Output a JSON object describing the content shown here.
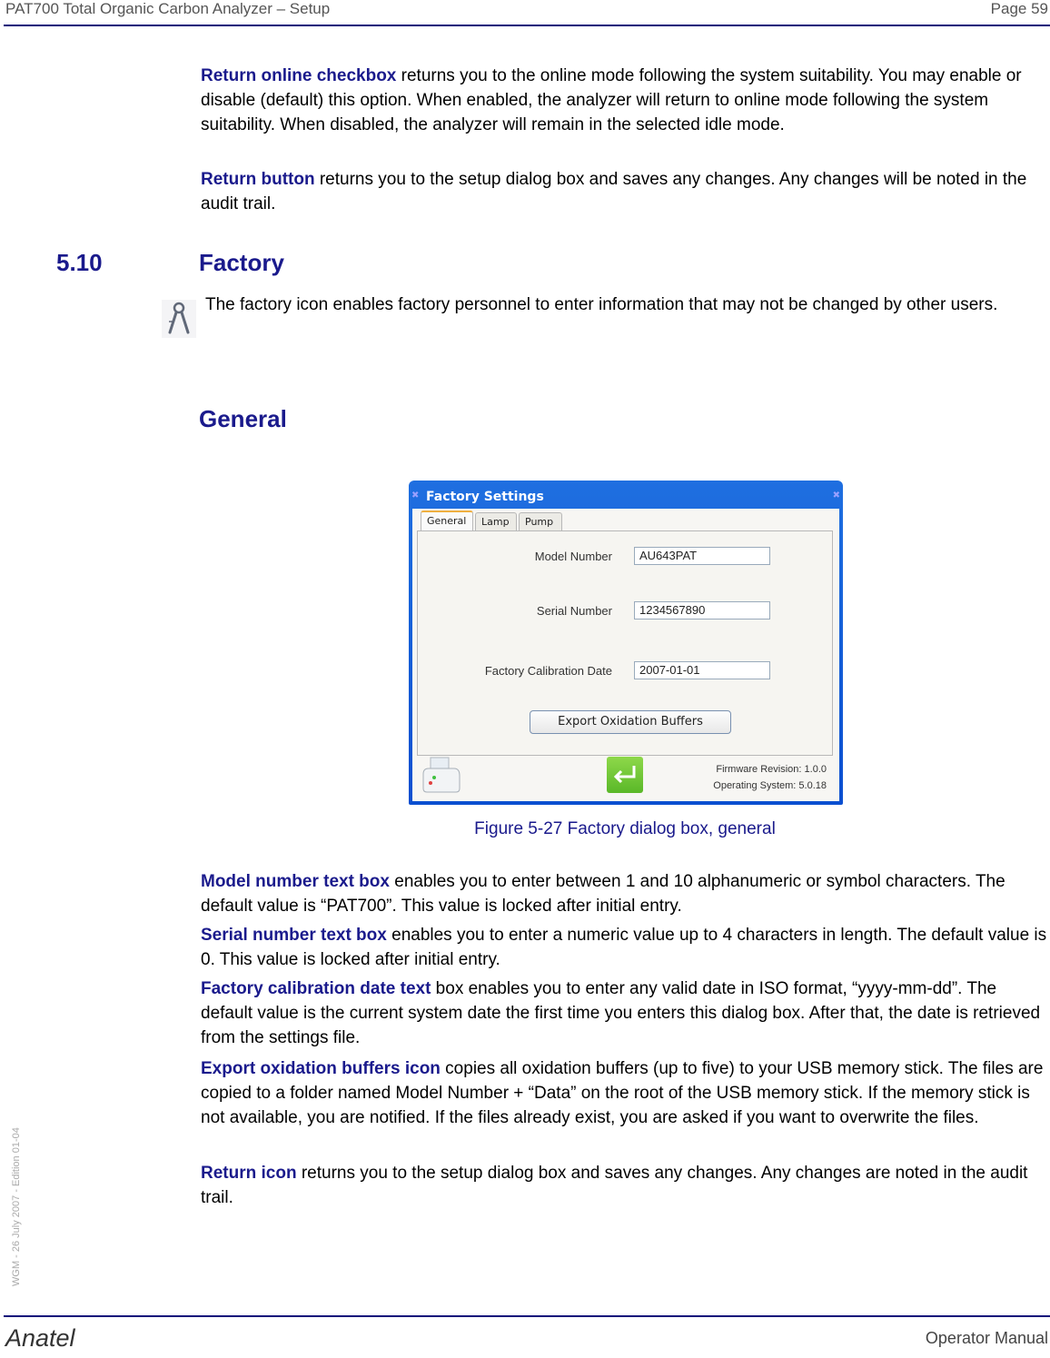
{
  "header": {
    "title": "PAT700 Total Organic Carbon Analyzer – Setup",
    "page": "Page 59"
  },
  "intro": [
    {
      "term": "Return online checkbox",
      "text": " returns you to the online mode following the system suitability. You may enable or disable (default) this option. When enabled, the analyzer will return to online mode following the system suitability. When disabled, the analyzer will remain in the selected idle mode."
    },
    {
      "term": "Return button",
      "text": " returns you to the setup dialog box and saves any changes. Any changes will be noted in the audit trail."
    }
  ],
  "section": {
    "number": "5.10",
    "title": "Factory",
    "icon": "compass-icon",
    "description": "The factory icon enables factory personnel to enter information that may not be changed by other users."
  },
  "subsection": {
    "title": "General"
  },
  "dialog": {
    "title": "Factory Settings",
    "tabs": [
      "General",
      "Lamp",
      "Pump"
    ],
    "active_tab": "General",
    "fields": [
      {
        "label": "Model Number",
        "value": "AU643PAT"
      },
      {
        "label": "Serial Number",
        "value": "1234567890"
      },
      {
        "label": "Factory Calibration Date",
        "value": "2007-01-01"
      }
    ],
    "export_button": "Export Oxidation Buffers",
    "firmware": "Firmware Revision: 1.0.0",
    "os": "Operating System: 5.0.18",
    "print_icon": "printer-icon",
    "return_icon": "return-arrow-icon",
    "accent_color": "#1560d8"
  },
  "caption": "Figure 5-27 Factory dialog box, general",
  "descriptions": [
    {
      "term": "Model number text box",
      "text": " enables you to enter between 1 and 10 alphanumeric or symbol characters. The default value is “PAT700”. This value is locked after initial entry."
    },
    {
      "term": "Serial number text box",
      "text": " enables you to enter a numeric value up to 4 characters in length. The default value is 0. This value is locked after initial entry."
    },
    {
      "term": "Factory calibration date text",
      "text": " box enables you to enter any valid date in ISO format, “yyyy-mm-dd”. The default value is the current system date the first time you enters this dialog box. After that, the date is retrieved from the settings file."
    },
    {
      "term": "Export oxidation buffers icon",
      "text": " copies all oxidation buffers (up to five) to your USB memory stick. The files are copied to a folder named Model Number + “Data” on the root of the USB memory stick. If the memory stick is not available, you are notified. If the files already exist, you are asked if you want to overwrite the files."
    },
    {
      "term": "Return icon",
      "text": " returns you to the setup dialog box and saves any changes. Any changes are noted in the audit trail."
    }
  ],
  "side_note": "WGM - 26 July 2007 - Edition 01-04",
  "footer": {
    "brand": "Anatel",
    "doc": "Operator Manual"
  }
}
